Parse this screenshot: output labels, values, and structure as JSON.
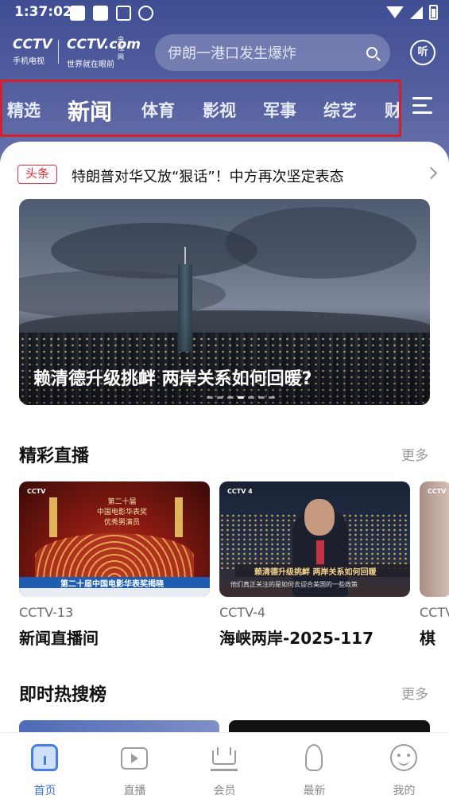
{
  "status_bar": {
    "time": "1:37:02",
    "icons": [
      "notification-square-icon",
      "notification-square-icon",
      "accessibility-icon",
      "sync-icon",
      "wifi-icon",
      "cellular-icon",
      "battery-icon"
    ]
  },
  "header": {
    "logo_primary": "CCTV",
    "logo_primary_sub": "手机电视",
    "logo_secondary": "CCTV.com",
    "logo_secondary_tag": "央视网",
    "logo_secondary_sub": "世界就在眼前",
    "search_placeholder": "伊朗一港口发生爆炸",
    "listen_label": "听"
  },
  "tabs": [
    {
      "label": "精选",
      "active": false
    },
    {
      "label": "新闻",
      "active": true
    },
    {
      "label": "体育",
      "active": false
    },
    {
      "label": "影视",
      "active": false
    },
    {
      "label": "军事",
      "active": false
    },
    {
      "label": "综艺",
      "active": false
    },
    {
      "label": "财",
      "active": false
    }
  ],
  "headline": {
    "badge": "头条",
    "text": "特朗普对华又放“狠话”！中方再次坚定表态"
  },
  "banner": {
    "caption": "赖清德升级挑衅 两岸关系如何回暖?",
    "dots_total": 7,
    "dots_active_index": 3
  },
  "live_section": {
    "title": "精彩直播",
    "more": "更多",
    "items": [
      {
        "channel": "CCTV-13",
        "title": "新闻直播间",
        "overlay": "第二十届中国电影华表奖揭晓",
        "logo": "CCTV",
        "stage_text": "第二十届\n中国电影华表奖\n优秀男演员"
      },
      {
        "channel": "CCTV-4",
        "title": "海峡两岸-2025-117",
        "overlay": "赖清德升级挑衅 两岸关系如何回暖",
        "overlay_sub": "他们真正关注的是如何去迎合美国的一些政策",
        "logo": "CCTV 4"
      },
      {
        "channel": "CCTV",
        "title": "棋",
        "logo": "CCTV"
      }
    ]
  },
  "hot_section": {
    "title": "即时热搜榜",
    "more": "更多"
  },
  "bottom_nav": [
    {
      "label": "首页",
      "icon": "home-icon",
      "active": true
    },
    {
      "label": "直播",
      "icon": "live-tv-icon",
      "active": false
    },
    {
      "label": "会员",
      "icon": "crown-icon",
      "active": false
    },
    {
      "label": "最新",
      "icon": "rocket-icon",
      "active": false
    },
    {
      "label": "我的",
      "icon": "profile-face-icon",
      "active": false
    }
  ],
  "colors": {
    "header_top": "#3f4d93",
    "header_bottom": "#6a73ab",
    "tab_highlight_border": "#d81e2a",
    "badge_red": "#e0303d",
    "nav_active": "#3a6fe0"
  }
}
